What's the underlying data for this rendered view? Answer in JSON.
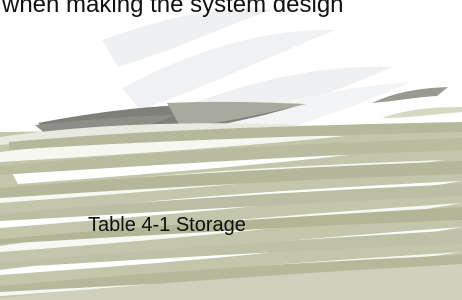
{
  "document": {
    "top_text": "when making the system design",
    "caption": "Table 4-1 Storage"
  },
  "colors": {
    "background": "#ffffff",
    "olive": "#b7b99b",
    "pale_olive": "#e6e7dc",
    "pale_gray": "#eef0f2",
    "dark_gray": "#7d7f77",
    "text": "#111111"
  }
}
